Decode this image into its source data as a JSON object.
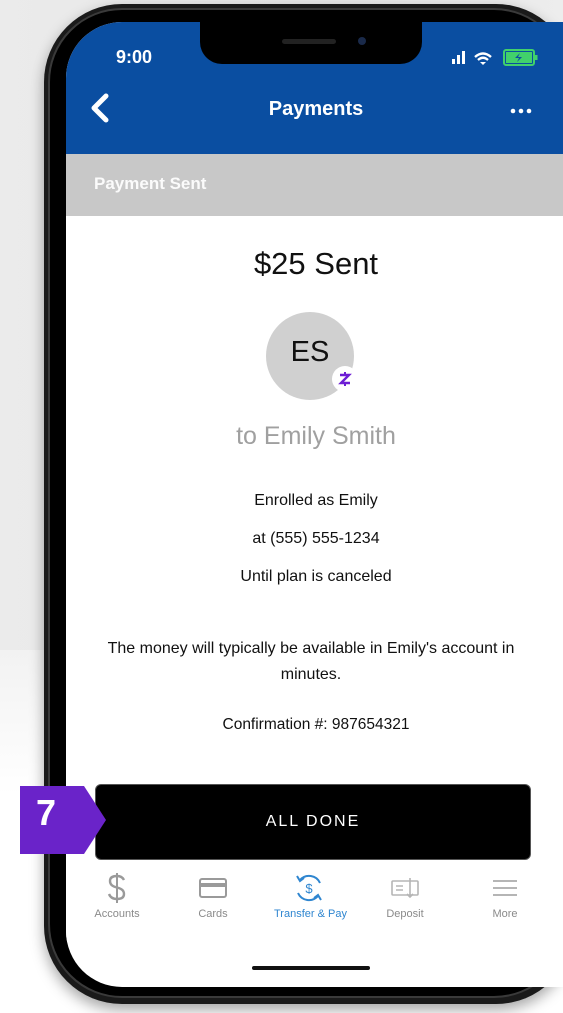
{
  "status": {
    "time": "9:00"
  },
  "header": {
    "title": "Payments"
  },
  "subheader": {
    "label": "Payment Sent"
  },
  "payment": {
    "amount_text": "$25 Sent",
    "initials": "ES",
    "recipient": "to Emily Smith",
    "enrolled": "Enrolled as Emily",
    "phone": "at (555) 555-1234",
    "duration": "Until plan is canceled",
    "notice": "The money will typically be available in Emily's account in minutes.",
    "confirmation": "Confirmation #: 987654321"
  },
  "actions": {
    "done_label": "ALL DONE"
  },
  "tabs": [
    {
      "label": "Accounts",
      "icon": "dollar-icon"
    },
    {
      "label": "Cards",
      "icon": "card-icon"
    },
    {
      "label": "Transfer & Pay",
      "icon": "transfer-icon",
      "active": true
    },
    {
      "label": "Deposit",
      "icon": "check-deposit-icon"
    },
    {
      "label": "More",
      "icon": "menu-icon"
    }
  ],
  "callout": {
    "step": "7"
  },
  "colors": {
    "brand_blue": "#0a4ea1",
    "active_tab": "#2f86d0",
    "callout_purple": "#6a23c9",
    "zelle_purple": "#6d1ed4"
  }
}
